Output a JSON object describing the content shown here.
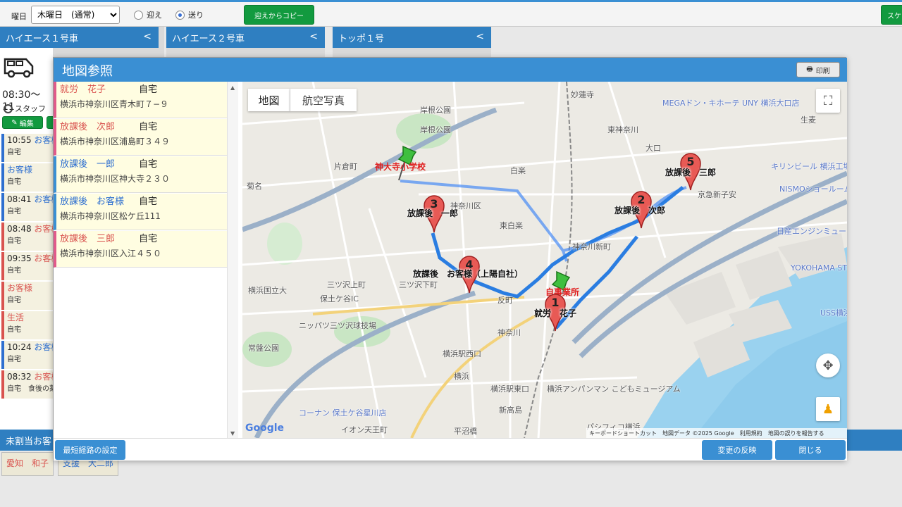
{
  "topbar": {
    "day_label": "曜日",
    "day_value": "木曜日　(通常)",
    "radio_pickup": "迎え",
    "radio_dropoff": "送り",
    "copy_button": "迎えからコピー",
    "right_button": "スケ"
  },
  "columns": [
    {
      "title": "ハイエース１号車"
    },
    {
      "title": "ハイエース２号車"
    },
    {
      "title": "トッポ１号"
    }
  ],
  "left_strip": {
    "time_range": "08:30〜11",
    "staff": "スタッフ",
    "edit": "編集",
    "cards": [
      {
        "time": "10:55",
        "name": "お客様",
        "sub": "自宅",
        "color": "#2e6fd0"
      },
      {
        "time": "",
        "name": "お客様",
        "sub": "自宅",
        "color": "#2e6fd0"
      },
      {
        "time": "08:41",
        "name": "お客様",
        "sub": "自宅",
        "color": "#2e6fd0"
      },
      {
        "time": "08:48",
        "name": "お客様",
        "sub": "自宅",
        "color": "#d9534f"
      },
      {
        "time": "09:35",
        "name": "お客様",
        "sub": "自宅",
        "color": "#d9534f"
      },
      {
        "time": "",
        "name": "お客様",
        "sub": "自宅",
        "color": "#d9534f"
      },
      {
        "time": "",
        "name": "生活",
        "sub": "自宅",
        "color": "#d9534f"
      },
      {
        "time": "10:24",
        "name": "お客様",
        "sub": "自宅",
        "color": "#2e6fd0"
      },
      {
        "time": "08:32",
        "name": "お客様",
        "sub": "自宅　食後の薬",
        "color": "#d9534f"
      }
    ]
  },
  "unassigned": {
    "title": "未割当お客",
    "cards": [
      {
        "name": "愛知　和子"
      },
      {
        "name": "支援　大二郎"
      }
    ]
  },
  "modal": {
    "title": "地図参照",
    "print_button": "印刷",
    "list": [
      {
        "name": "就労　花子",
        "place": "自宅",
        "address": "横浜市神奈川区青木町７−９",
        "name_color": "#d9534f",
        "bar_color": "#e05a8a"
      },
      {
        "name": "放課後　次郎",
        "place": "自宅",
        "address": "横浜市神奈川区浦島町３４９",
        "name_color": "#d9534f",
        "bar_color": "#e05a8a"
      },
      {
        "name": "放課後　一郎",
        "place": "自宅",
        "address": "横浜市神奈川区神大寺２３０",
        "name_color": "#2e6fd0",
        "bar_color": "#3a8fd3"
      },
      {
        "name": "放課後　お客様",
        "place": "自宅",
        "address": "横浜市神奈川区松ケ丘111",
        "name_color": "#2e6fd0",
        "bar_color": "#3a8fd3"
      },
      {
        "name": "放課後　三郎",
        "place": "自宅",
        "address": "横浜市神奈川区入江４５０",
        "name_color": "#d9534f",
        "bar_color": "#e05a8a"
      }
    ],
    "footer": {
      "shortest_route": "最短経路の設定",
      "apply": "変更の反映",
      "close": "閉じる"
    }
  },
  "map": {
    "tab_map": "地図",
    "tab_satellite": "航空写真",
    "markers": [
      {
        "number": "1",
        "label": "就労　花子"
      },
      {
        "number": "2",
        "label": "放課後　次郎"
      },
      {
        "number": "3",
        "label": "放課後　一郎"
      },
      {
        "number": "4",
        "label": "放課後　お客様（上陽自社）"
      },
      {
        "number": "5",
        "label": "放課後　三郎"
      }
    ],
    "pins": [
      {
        "label": "神大寺小学校"
      },
      {
        "label": "自事業所"
      }
    ],
    "place_labels": [
      "妙蓮寺",
      "岸根公園",
      "岸根公園",
      "白楽",
      "東白楽",
      "神奈川区",
      "神奈川新町",
      "三ツ沢上町",
      "三ツ沢下町",
      "反町",
      "神奈川",
      "横浜国立大",
      "保土ケ谷IC",
      "ニッパツ三ツ沢球技場",
      "常盤公園",
      "横浜駅西口",
      "横浜",
      "横浜駅東口",
      "新高島",
      "平沼橋",
      "コーナン 保土ケ谷星川店",
      "イオン天王町",
      "横浜アンパンマン こどもミュージアム",
      "パシフィコ横浜",
      "大口",
      "生麦",
      "キリンビール 横浜工場",
      "NISMOショールーム",
      "日産エンジンミュージアム",
      "YOKOHAMA STRAWBERRY",
      "USS横浜",
      "MEGAドン・キホーテ UNY 横浜大口店",
      "京急新子安",
      "東神奈川",
      "片倉町",
      "菊名"
    ],
    "footer_text": {
      "shortcuts": "キーボードショートカット",
      "data": "地図データ ©2025 Google",
      "terms": "利用規約",
      "report": "地図の誤りを報告する",
      "google": "Google"
    }
  }
}
